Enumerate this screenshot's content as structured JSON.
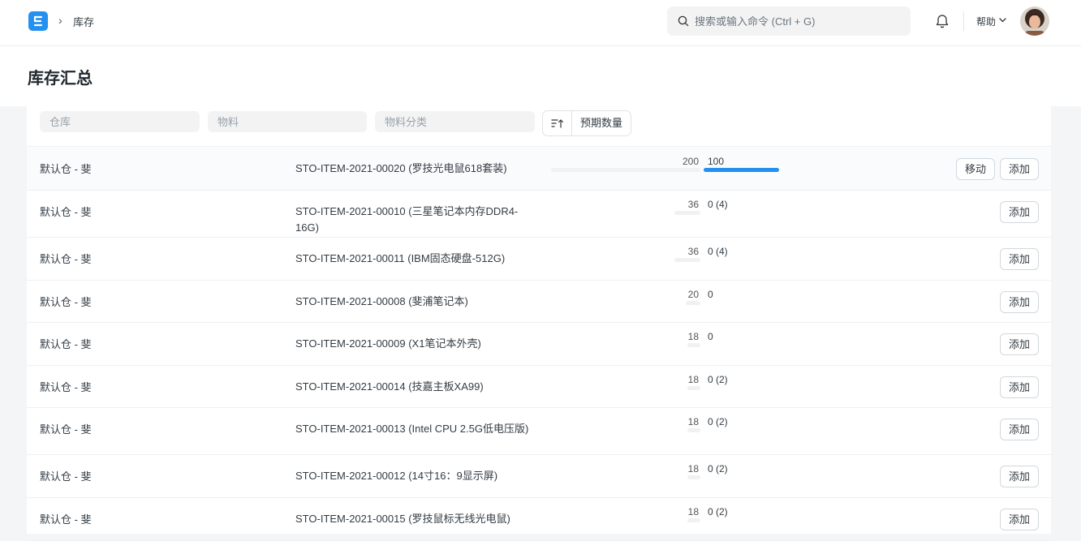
{
  "navbar": {
    "breadcrumb": "库存",
    "search_placeholder": "搜索或输入命令 (Ctrl + G)",
    "help_label": "帮助"
  },
  "page": {
    "title": "库存汇总"
  },
  "filters": {
    "warehouse_placeholder": "仓库",
    "item_placeholder": "物料",
    "item_group_placeholder": "物料分类",
    "sort_label": "预期数量"
  },
  "buttons": {
    "move": "移动",
    "add": "添加"
  },
  "colors": {
    "accent": "#2490ef"
  },
  "rows": [
    {
      "warehouse": "默认仓 - 斐",
      "item": "STO-ITEM-2021-00020 (罗技光电鼠618套装)",
      "qty": "200",
      "projected": "100",
      "projected_value": 100,
      "max_value": 200,
      "has_move": true
    },
    {
      "warehouse": "默认仓 - 斐",
      "item": "STO-ITEM-2021-00010 (三星笔记本内存DDR4-16G)",
      "qty": "36",
      "projected": "0 (4)",
      "projected_value": 0,
      "max_value": 36,
      "has_move": false
    },
    {
      "warehouse": "默认仓 - 斐",
      "item": "STO-ITEM-2021-00011 (IBM固态硬盘-512G)",
      "qty": "36",
      "projected": "0 (4)",
      "projected_value": 0,
      "max_value": 36,
      "has_move": false
    },
    {
      "warehouse": "默认仓 - 斐",
      "item": "STO-ITEM-2021-00008 (斐浦笔记本)",
      "qty": "20",
      "projected": "0",
      "projected_value": 0,
      "max_value": 20,
      "has_move": false
    },
    {
      "warehouse": "默认仓 - 斐",
      "item": "STO-ITEM-2021-00009 (X1笔记本外壳)",
      "qty": "18",
      "projected": "0",
      "projected_value": 0,
      "max_value": 18,
      "has_move": false
    },
    {
      "warehouse": "默认仓 - 斐",
      "item": "STO-ITEM-2021-00014 (技嘉主板XA99)",
      "qty": "18",
      "projected": "0 (2)",
      "projected_value": 0,
      "max_value": 18,
      "has_move": false
    },
    {
      "warehouse": "默认仓 - 斐",
      "item": "STO-ITEM-2021-00013 (Intel CPU 2.5G低电压版)",
      "qty": "18",
      "projected": "0 (2)",
      "projected_value": 0,
      "max_value": 18,
      "has_move": false
    },
    {
      "warehouse": "默认仓 - 斐",
      "item": "STO-ITEM-2021-00012 (14寸16：9显示屏)",
      "qty": "18",
      "projected": "0 (2)",
      "projected_value": 0,
      "max_value": 18,
      "has_move": false
    },
    {
      "warehouse": "默认仓 - 斐",
      "item": "STO-ITEM-2021-00015 (罗技鼠标无线光电鼠)",
      "qty": "18",
      "projected": "0 (2)",
      "projected_value": 0,
      "max_value": 18,
      "has_move": false
    }
  ]
}
